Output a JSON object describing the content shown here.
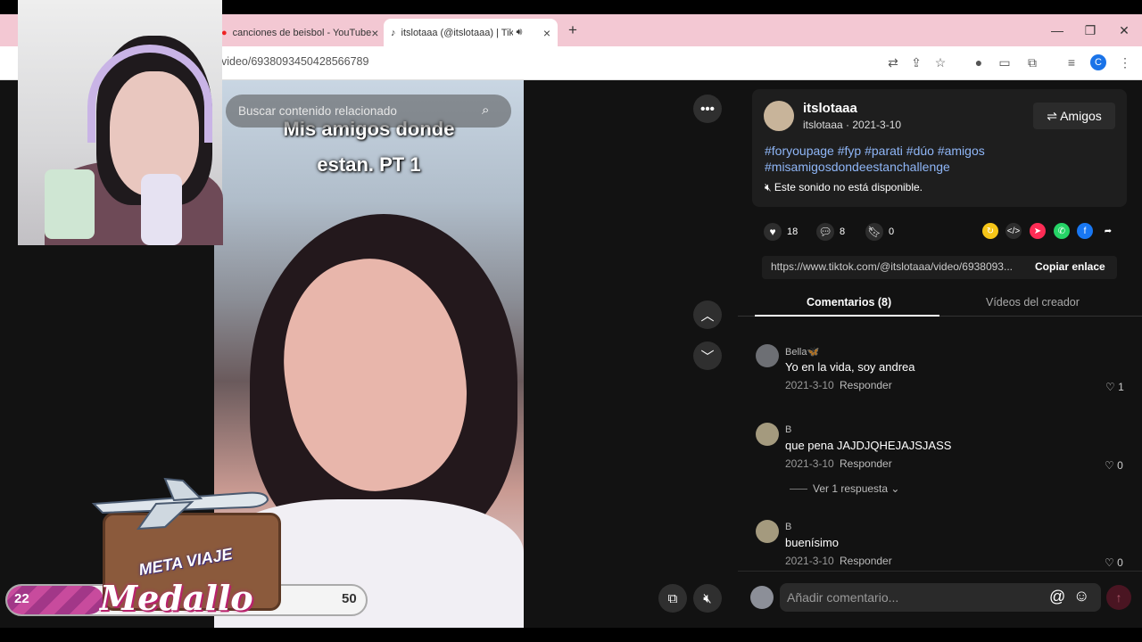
{
  "browser": {
    "tabs": [
      {
        "title": "canciones de beisbol - YouTube",
        "close": "×"
      },
      {
        "title": "itslotaaa (@itslotaaa) | TikT",
        "close": "×"
      }
    ],
    "new_tab": "+",
    "url": "video/6938093450428566789",
    "win_minimize": "—",
    "win_restore": "❐",
    "win_close": "✕",
    "profile_letter": "C"
  },
  "video": {
    "search_placeholder": "Buscar contenido relacionado",
    "caption_line1": "Mis amigos donde",
    "caption_line2": "estan. PT 1"
  },
  "post": {
    "username": "itslotaaa",
    "meta": "itslotaaa · 2021-3-10",
    "friends_button": "⇌ Amigos",
    "hashtags": "#foryoupage #fyp #parati #dúo #amigos #misamigosdondeestanchallenge",
    "sound": "Este sonido no está disponible.",
    "likes": "18",
    "comments": "8",
    "saves": "0",
    "link": "https://www.tiktok.com/@itslotaaa/video/6938093...",
    "copy_link": "Copiar enlace"
  },
  "tabs": {
    "comments": "Comentarios (8)",
    "creator_videos": "Vídeos del creador"
  },
  "comments": [
    {
      "user": "Bella🦋",
      "text": "Yo en la vida, soy andrea",
      "date": "2021-3-10",
      "reply": "Responder",
      "likes": "1"
    },
    {
      "user": "B",
      "text": "que pena JAJDJQHEJAJSJASS",
      "date": "2021-3-10",
      "reply": "Responder",
      "likes": "0",
      "replies_link": "Ver 1 respuesta ⌄"
    },
    {
      "user": "B",
      "text": "buenísimo",
      "date": "2021-3-10",
      "reply": "Responder",
      "likes": "0"
    }
  ],
  "composer": {
    "placeholder": "Añadir comentario..."
  },
  "overlay": {
    "meter_left": "22",
    "meter_right": "50",
    "meter_progress": 0.22,
    "badge_top": "META VIAJE",
    "badge_main": "Medallo"
  }
}
